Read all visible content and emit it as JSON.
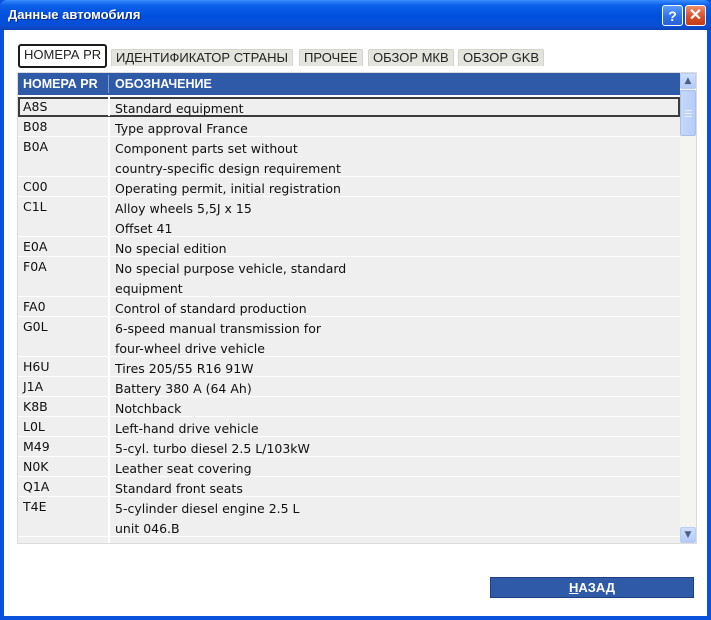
{
  "window": {
    "title": "Данные автомобиля",
    "help_glyph": "?",
    "close_glyph": "✕"
  },
  "tabs": [
    {
      "label": "НОМЕРА PR",
      "active": true
    },
    {
      "label": "ИДЕНТИФИКАТОР СТРАНЫ",
      "active": false
    },
    {
      "label": "ПРОЧЕЕ",
      "active": false
    },
    {
      "label": "ОБЗОР МКВ",
      "active": false
    },
    {
      "label": "ОБЗОР GKB",
      "active": false
    }
  ],
  "table": {
    "columns": [
      "НОМЕРА PR",
      "ОБОЗНАЧЕНИЕ"
    ],
    "rows": [
      {
        "code": "A8S",
        "desc": "Standard equipment",
        "lines": 1,
        "selected": true
      },
      {
        "code": "B08",
        "desc": "Type approval France",
        "lines": 1
      },
      {
        "code": "B0A",
        "desc": "Component parts set without\ncountry-specific design requirement",
        "lines": 2
      },
      {
        "code": "C00",
        "desc": "Operating permit, initial registration",
        "lines": 1
      },
      {
        "code": "C1L",
        "desc": "Alloy wheels 5,5J x 15\nOffset 41",
        "lines": 2
      },
      {
        "code": "E0A",
        "desc": "No special edition",
        "lines": 1
      },
      {
        "code": "F0A",
        "desc": "No special purpose vehicle, standard\nequipment",
        "lines": 2
      },
      {
        "code": "FA0",
        "desc": "Control of standard production",
        "lines": 1
      },
      {
        "code": "G0L",
        "desc": "6-speed manual transmission for\nfour-wheel drive vehicle",
        "lines": 2
      },
      {
        "code": "H6U",
        "desc": "Tires 205/55 R16 91W",
        "lines": 1
      },
      {
        "code": "J1A",
        "desc": "Battery 380 A (64 Ah)",
        "lines": 1
      },
      {
        "code": "K8B",
        "desc": "Notchback",
        "lines": 1
      },
      {
        "code": "L0L",
        "desc": "Left-hand drive vehicle",
        "lines": 1
      },
      {
        "code": "M49",
        "desc": "5-cyl. turbo diesel 2.5 L/103kW",
        "lines": 1
      },
      {
        "code": "N0K",
        "desc": "Leather seat covering",
        "lines": 1
      },
      {
        "code": "Q1A",
        "desc": "Standard front seats",
        "lines": 1
      },
      {
        "code": "T4E",
        "desc": "5-cylinder diesel engine 2.5 L\nunit 046.B",
        "lines": 2
      },
      {
        "code": "",
        "desc": "",
        "lines": 1
      }
    ]
  },
  "buttons": {
    "back_label_underlined": "Н",
    "back_label_rest": "АЗАД"
  },
  "colors": {
    "title_bar": "#0050dd",
    "header_bg": "#2f5aa8",
    "row_bg": "#efefef"
  }
}
